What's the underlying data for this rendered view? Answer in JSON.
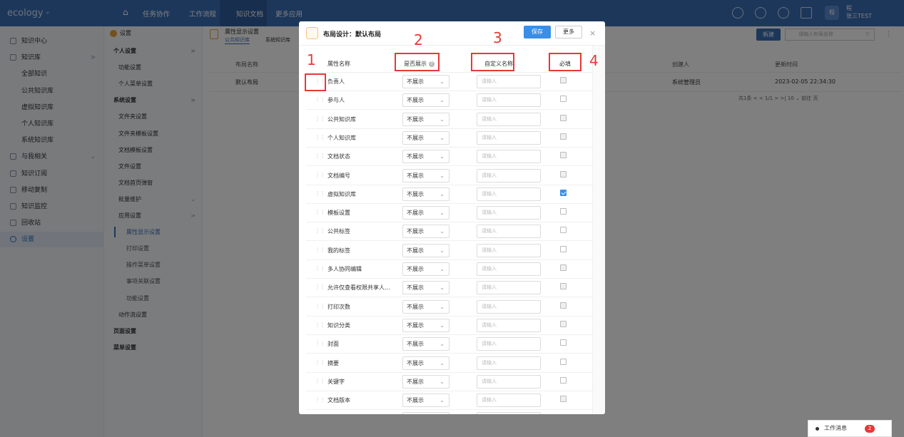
{
  "header": {
    "logo": "ecology",
    "nav": [
      "任务协作",
      "工作流程",
      "知识文档",
      "更多应用"
    ],
    "user_initial": "程",
    "user_line1": "程",
    "user_name": "张三TEST"
  },
  "left_nav": {
    "items": [
      {
        "label": "知识中心",
        "level": 0,
        "arrow": ""
      },
      {
        "label": "知识库",
        "level": 0,
        "arrow": ">"
      },
      {
        "label": "全部知识",
        "level": 1,
        "arrow": ""
      },
      {
        "label": "公共知识库",
        "level": 1,
        "arrow": ""
      },
      {
        "label": "虚拟知识库",
        "level": 1,
        "arrow": ""
      },
      {
        "label": "个人知识库",
        "level": 1,
        "arrow": ""
      },
      {
        "label": "系统知识库",
        "level": 1,
        "arrow": ""
      },
      {
        "label": "与我相关",
        "level": 0,
        "arrow": "⌄"
      },
      {
        "label": "知识订阅",
        "level": 0,
        "arrow": ""
      },
      {
        "label": "移动复制",
        "level": 0,
        "arrow": ""
      },
      {
        "label": "知识监控",
        "level": 0,
        "arrow": ""
      },
      {
        "label": "回收站",
        "level": 0,
        "arrow": ""
      },
      {
        "label": "设置",
        "level": 0,
        "arrow": "",
        "active": true
      }
    ]
  },
  "settings_nav": {
    "title": "设置",
    "items": [
      {
        "label": "个人设置",
        "level": 0,
        "arrow": ">"
      },
      {
        "label": "功能设置",
        "level": 1,
        "arrow": ""
      },
      {
        "label": "个人菜单设置",
        "level": 1,
        "arrow": ""
      },
      {
        "label": "系统设置",
        "level": 0,
        "arrow": ">"
      },
      {
        "label": "文件夹设置",
        "level": 1,
        "arrow": ""
      },
      {
        "label": "文件夹模板设置",
        "level": 1,
        "arrow": ""
      },
      {
        "label": "文档模板设置",
        "level": 1,
        "arrow": ""
      },
      {
        "label": "文件设置",
        "level": 1,
        "arrow": ""
      },
      {
        "label": "文档首页弹窗",
        "level": 1,
        "arrow": ""
      },
      {
        "label": "批量维护",
        "level": 1,
        "arrow": "⌄"
      },
      {
        "label": "应用设置",
        "level": 1,
        "arrow": ">"
      },
      {
        "label": "属性显示设置",
        "level": 2,
        "arrow": "",
        "active": true
      },
      {
        "label": "打印设置",
        "level": 2,
        "arrow": ""
      },
      {
        "label": "操作菜单设置",
        "level": 2,
        "arrow": ""
      },
      {
        "label": "事项关联设置",
        "level": 2,
        "arrow": ""
      },
      {
        "label": "功能设置",
        "level": 2,
        "arrow": ""
      },
      {
        "label": "动作流设置",
        "level": 1,
        "arrow": ""
      },
      {
        "label": "页面设置",
        "level": 0,
        "arrow": ""
      },
      {
        "label": "菜单设置",
        "level": 0,
        "arrow": ""
      }
    ]
  },
  "content": {
    "title": "属性显示设置",
    "tabs": [
      "公共知识库",
      "系统知识库"
    ],
    "new_button": "新建",
    "search_placeholder": "请输入布局名称",
    "columns": [
      "布局名称",
      "创建人",
      "更新时间"
    ],
    "row": {
      "name": "默认布局",
      "creator": "系统管理员",
      "updated": "2023-02-05 22:34:30"
    },
    "pager": "共1条   <   <   1/1   >   >|   10 ⌄   前往        页"
  },
  "modal": {
    "title": "布局设计：默认布局",
    "save": "保存",
    "more": "更多",
    "close": "×",
    "col_name": "属性名称",
    "col_show": "是否展示",
    "col_custom": "自定义名称",
    "col_required": "必填",
    "select_value": "不展示",
    "input_placeholder": "请输入",
    "rows": [
      {
        "name": "负责人",
        "required": "disabled"
      },
      {
        "name": "参与人",
        "required": "off"
      },
      {
        "name": "公共知识库",
        "required": "disabled"
      },
      {
        "name": "个人知识库",
        "required": "disabled"
      },
      {
        "name": "文档状态",
        "required": "disabled"
      },
      {
        "name": "文档编号",
        "required": "disabled"
      },
      {
        "name": "虚拟知识库",
        "required": "on"
      },
      {
        "name": "模板设置",
        "required": "off"
      },
      {
        "name": "公共标签",
        "required": "off"
      },
      {
        "name": "我的标签",
        "required": "off"
      },
      {
        "name": "多人协同编辑",
        "required": "disabled"
      },
      {
        "name": "允许仅查看权限共享人...",
        "required": "disabled"
      },
      {
        "name": "打印次数",
        "required": "disabled"
      },
      {
        "name": "知识分类",
        "required": "disabled"
      },
      {
        "name": "封面",
        "required": "off"
      },
      {
        "name": "摘要",
        "required": "off"
      },
      {
        "name": "关键字",
        "required": "off"
      },
      {
        "name": "文档版本",
        "required": "disabled"
      },
      {
        "name": "",
        "required": "off"
      }
    ]
  },
  "annotations": [
    "1",
    "2",
    "3",
    "4"
  ],
  "message": {
    "label": "工作消息",
    "count": "2"
  },
  "colors": {
    "brand": "#3a6fb7",
    "annotation": "#e53935",
    "primary_button": "#3a8ee6"
  }
}
